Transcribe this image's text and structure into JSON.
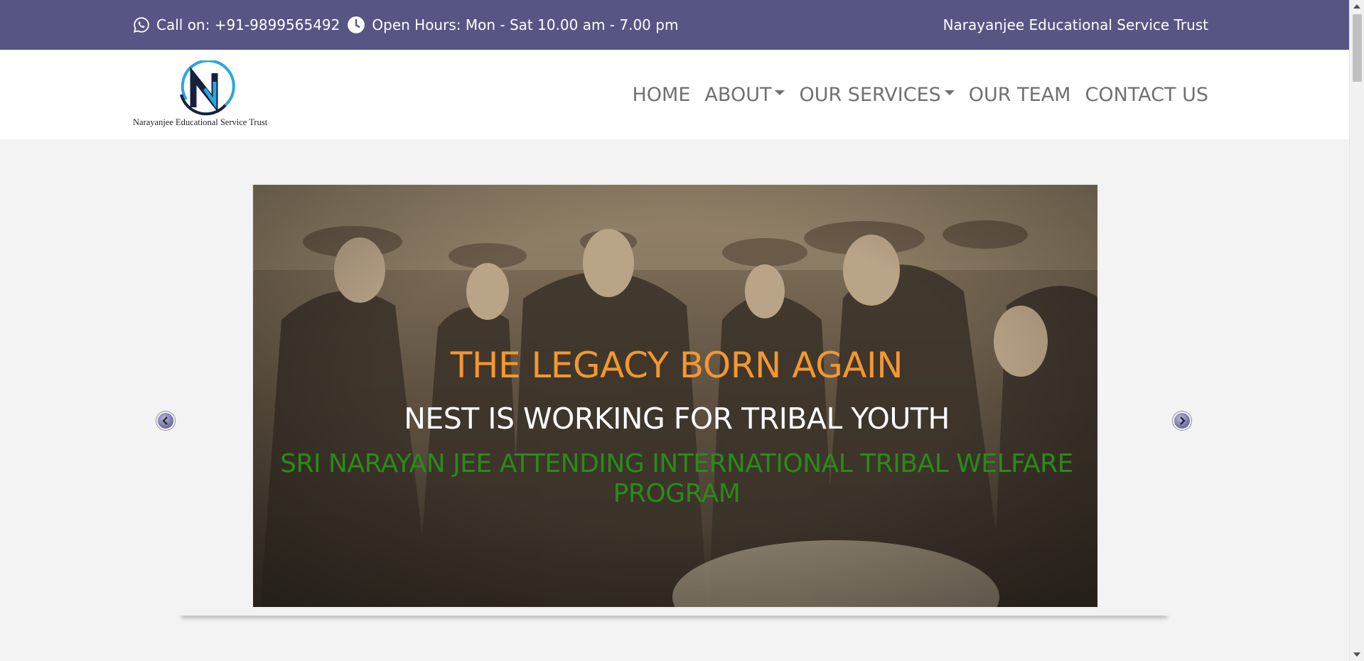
{
  "topbar": {
    "phone_icon": "whatsapp-icon",
    "phone_text": "Call on: +91-9899565492",
    "hours_icon": "clock-icon",
    "hours_text": "Open Hours: Mon - Sat 10.00 am - 7.00 pm",
    "org_name": "Narayanjee Educational Service Trust",
    "background": "#565584"
  },
  "header": {
    "logo_caption": "Narayanjee Educational Service Trust",
    "logo_letter": "N",
    "nav": [
      {
        "label": "HOME",
        "dropdown": false
      },
      {
        "label": "ABOUT",
        "dropdown": true
      },
      {
        "label": "OUR SERVICES",
        "dropdown": true
      },
      {
        "label": "OUR TEAM",
        "dropdown": false
      },
      {
        "label": "CONTACT US",
        "dropdown": false
      }
    ]
  },
  "slider": {
    "heading": "THE LEGACY BORN AGAIN",
    "subheading": "NEST IS WORKING FOR TRIBAL YOUTH",
    "description": "SRI NARAYAN JEE ATTENDING INTERNATIONAL TRIBAL WELFARE PROGRAM",
    "prev_icon": "chevron-left-icon",
    "next_icon": "chevron-right-icon",
    "colors": {
      "heading": "#f29731",
      "subheading": "#ffffff",
      "description": "#2a8a1a"
    }
  }
}
